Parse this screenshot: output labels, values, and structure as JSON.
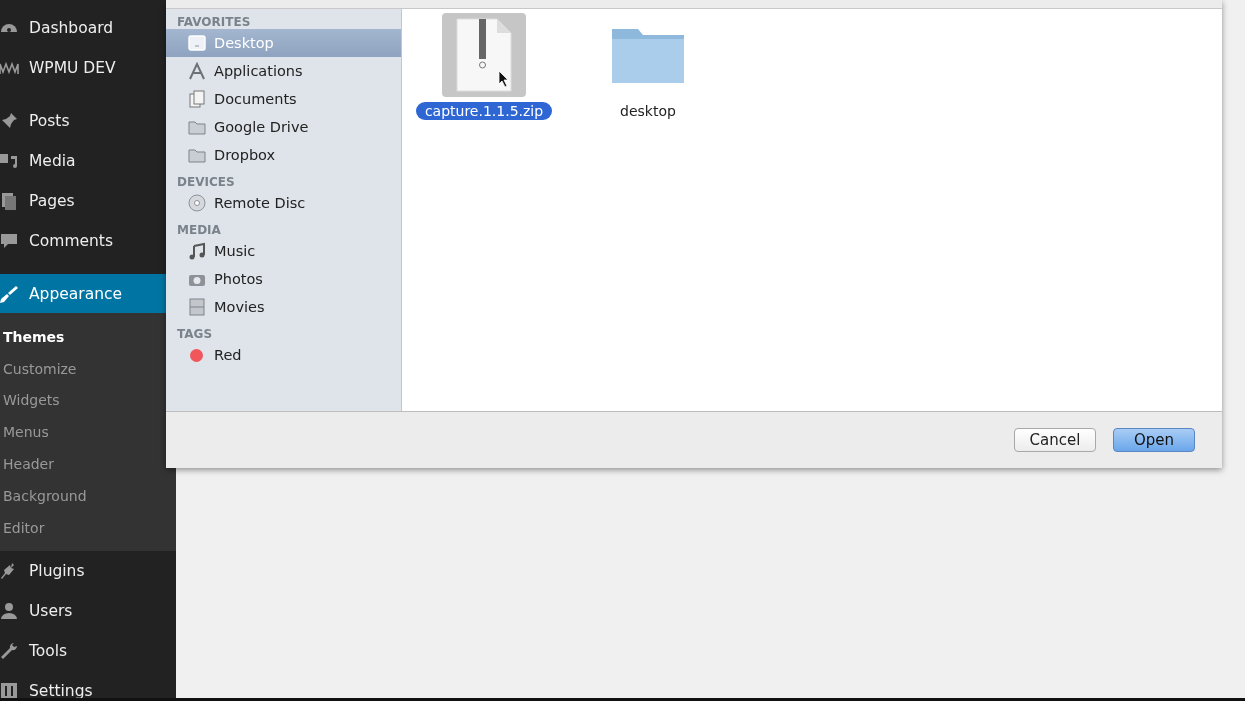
{
  "admin_menu": {
    "groups": [
      {
        "items": [
          {
            "label": "Dashboard",
            "kind": "gauge",
            "selected": false
          },
          {
            "label": "WPMU DEV",
            "kind": "wave",
            "selected": false
          }
        ]
      },
      {
        "items": [
          {
            "label": "Posts",
            "kind": "pin",
            "selected": false
          },
          {
            "label": "Media",
            "kind": "media",
            "selected": false
          },
          {
            "label": "Pages",
            "kind": "pages",
            "selected": false
          },
          {
            "label": "Comments",
            "kind": "bubble",
            "selected": false
          }
        ]
      },
      {
        "items": [
          {
            "label": "Appearance",
            "kind": "brush",
            "selected": true,
            "children": [
              {
                "label": "Themes",
                "selected": true
              },
              {
                "label": "Customize",
                "selected": false
              },
              {
                "label": "Widgets",
                "selected": false
              },
              {
                "label": "Menus",
                "selected": false
              },
              {
                "label": "Header",
                "selected": false
              },
              {
                "label": "Background",
                "selected": false
              },
              {
                "label": "Editor",
                "selected": false
              }
            ]
          },
          {
            "label": "Plugins",
            "kind": "plug",
            "selected": false
          },
          {
            "label": "Users",
            "kind": "user",
            "selected": false
          },
          {
            "label": "Tools",
            "kind": "wrench",
            "selected": false
          },
          {
            "label": "Settings",
            "kind": "sliders",
            "selected": false
          }
        ]
      }
    ]
  },
  "open_dialog": {
    "sidebar": [
      {
        "heading": "FAVORITES",
        "items": [
          {
            "label": "Desktop",
            "kind": "desktop",
            "selected": true
          },
          {
            "label": "Applications",
            "kind": "apps",
            "selected": false
          },
          {
            "label": "Documents",
            "kind": "docs",
            "selected": false
          },
          {
            "label": "Google Drive",
            "kind": "folder",
            "selected": false
          },
          {
            "label": "Dropbox",
            "kind": "folder",
            "selected": false
          }
        ]
      },
      {
        "heading": "DEVICES",
        "items": [
          {
            "label": "Remote Disc",
            "kind": "disc",
            "selected": false
          }
        ]
      },
      {
        "heading": "MEDIA",
        "items": [
          {
            "label": "Music",
            "kind": "music",
            "selected": false
          },
          {
            "label": "Photos",
            "kind": "camera",
            "selected": false
          },
          {
            "label": "Movies",
            "kind": "film",
            "selected": false
          }
        ]
      },
      {
        "heading": "TAGS",
        "items": [
          {
            "label": "Red",
            "kind": "tag",
            "selected": false,
            "color": "#f0565a"
          }
        ]
      }
    ],
    "files": [
      {
        "name": "capture.1.1.5.zip",
        "kind": "zip",
        "selected": true
      },
      {
        "name": "desktop",
        "kind": "folder",
        "selected": false
      }
    ],
    "buttons": [
      {
        "label": "Cancel",
        "default": false
      },
      {
        "label": "Open",
        "default": true
      }
    ]
  }
}
